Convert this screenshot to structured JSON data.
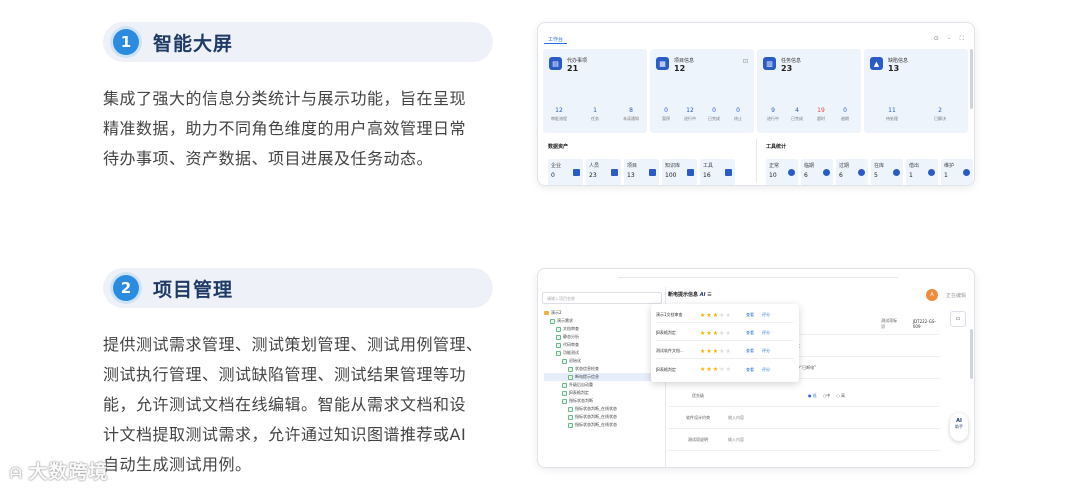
{
  "section1": {
    "number": "1",
    "title": "智能大屏",
    "desc_lines": [
      "集成了强大的信息分类统计与展示功能，旨在呈现",
      "精准数据，助力不同角色维度的用户高效管理日常",
      "待办事项、资产数据、项目进展及任务动态。"
    ],
    "screenshot": {
      "tab": "工作台",
      "window_controls": [
        "⊙",
        "–",
        "⛶"
      ],
      "cards": [
        {
          "icon": "clipboard-icon",
          "title": "代办事项",
          "count": "21",
          "stats": [
            {
              "value": "12",
              "label": "审批流程"
            },
            {
              "value": "1",
              "label": "任务"
            },
            {
              "value": "8",
              "label": "未读通知"
            }
          ]
        },
        {
          "icon": "briefcase-icon",
          "title": "项目信息",
          "count": "12",
          "ext": "⊡",
          "stats": [
            {
              "value": "0",
              "label": "暂停"
            },
            {
              "value": "12",
              "label": "进行中"
            },
            {
              "value": "0",
              "label": "已完成"
            },
            {
              "value": "0",
              "label": "终止"
            }
          ]
        },
        {
          "icon": "calendar-icon",
          "title": "任务信息",
          "count": "23",
          "stats": [
            {
              "value": "9",
              "label": "进行中"
            },
            {
              "value": "4",
              "label": "已完成"
            },
            {
              "value": "19",
              "label": "超时",
              "color": "#e04848"
            },
            {
              "value": "0",
              "label": "逾期"
            }
          ]
        },
        {
          "icon": "warning-icon",
          "title": "缺陷信息",
          "count": "13",
          "stats": [
            {
              "value": "11",
              "label": "待处理"
            },
            {
              "value": "2",
              "label": "已解决"
            }
          ]
        }
      ],
      "asset_section_title": "数据资产",
      "assets": [
        {
          "label": "企业",
          "value": "0"
        },
        {
          "label": "人员",
          "value": "23"
        },
        {
          "label": "项目",
          "value": "13"
        },
        {
          "label": "知识库",
          "value": "100"
        },
        {
          "label": "工具",
          "value": "16"
        }
      ],
      "tool_section_title": "工具统计",
      "tools": [
        {
          "label": "正常",
          "value": "10"
        },
        {
          "label": "临期",
          "value": "6"
        },
        {
          "label": "过期",
          "value": "6"
        },
        {
          "label": "在库",
          "value": "5"
        },
        {
          "label": "借出",
          "value": "1"
        },
        {
          "label": "维护",
          "value": "1"
        }
      ]
    }
  },
  "section2": {
    "number": "2",
    "title": "项目管理",
    "desc_lines": [
      "提供测试需求管理、测试策划管理、测试用例管理、",
      "测试执行管理、测试缺陷管理、测试结果管理等功",
      "能，允许测试文档在线编辑。智能从需求文档和设",
      "计文档提取测试需求，允许通过知识图谱推荐或AI",
      "自动生成测试用例。"
    ],
    "screenshot": {
      "search_placeholder": "请输入项目名称",
      "tree": [
        {
          "label": "演示2",
          "indent": 0,
          "type": "folder"
        },
        {
          "label": "演示需求",
          "indent": 1,
          "type": "doc"
        },
        {
          "label": "文档审查",
          "indent": 2,
          "type": "doc"
        },
        {
          "label": "静态分析",
          "indent": 2,
          "type": "doc"
        },
        {
          "label": "代码审查",
          "indent": 2,
          "type": "doc"
        },
        {
          "label": "功能测试",
          "indent": 2,
          "type": "doc"
        },
        {
          "label": "初始化",
          "indent": 3,
          "type": "doc"
        },
        {
          "label": "状态信息检查",
          "indent": 4,
          "type": "doc"
        },
        {
          "label": "断电提示信息",
          "indent": 4,
          "type": "doc",
          "selected": true
        },
        {
          "label": "升级后自动重",
          "indent": 3,
          "type": "doc"
        },
        {
          "label": "JB表格判定",
          "indent": 3,
          "type": "doc"
        },
        {
          "label": "指标状态判断",
          "indent": 3,
          "type": "doc"
        },
        {
          "label": "指标状态判断_在线状态",
          "indent": 4,
          "type": "doc"
        },
        {
          "label": "指标状态判断_在线状态",
          "indent": 4,
          "type": "doc"
        },
        {
          "label": "指标状态判断_在线状态",
          "indent": 4,
          "type": "doc"
        }
      ],
      "header_title": "断电提示信息",
      "header_ai": "AI",
      "avatar_text": "A",
      "edit_label": "正在编辑",
      "popup_rows": [
        {
          "name": "演示1文档审查",
          "stars": 3,
          "view": "查看",
          "rate": "评分"
        },
        {
          "name": "JB表格判定",
          "stars": 3,
          "view": "查看",
          "rate": "评分"
        },
        {
          "name": "测试软件文档...",
          "stars": 3,
          "view": "查看",
          "rate": "评分"
        },
        {
          "name": "JB表格判定",
          "stars": 3,
          "view": "查看",
          "rate": "评分"
        }
      ],
      "form_rows": [
        {
          "label": "",
          "value": "测试项标识",
          "extra": "JDT222-GS-009"
        },
        {
          "label": "",
          "value": "",
          "extra": "文"
        },
        {
          "label": "",
          "value": "",
          "extra": "中“已断电”"
        },
        {
          "label": "优先级",
          "value": "radio",
          "extra": ""
        },
        {
          "label": "软件设计约束",
          "value": "输入内容",
          "extra": ""
        },
        {
          "label": "测试项说明",
          "value": "输入内容",
          "extra": ""
        }
      ],
      "priority_options": [
        "低",
        "中",
        "高"
      ],
      "ai_button": "AI",
      "ai_button_sub": "助手"
    }
  },
  "watermark": "大数跨境"
}
